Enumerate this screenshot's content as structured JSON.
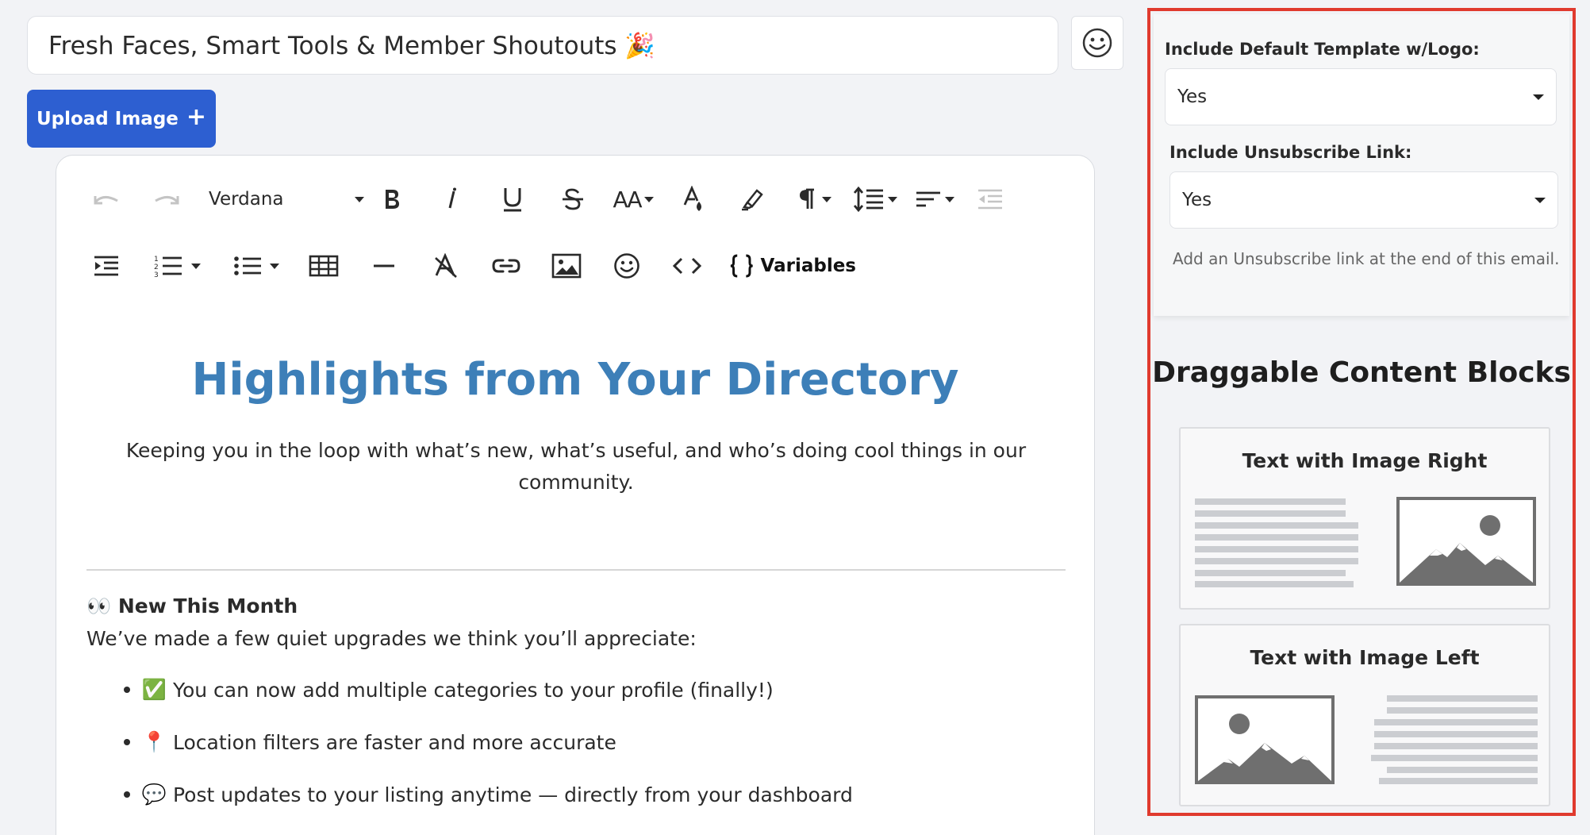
{
  "subject": {
    "value": "Fresh Faces, Smart Tools & Member Shoutouts 🎉"
  },
  "emoji_picker": {
    "icon": "smiley-icon"
  },
  "upload": {
    "label": "Upload Image",
    "plus": "+"
  },
  "toolbar": {
    "font_family": "Verdana",
    "variables_label": "Variables",
    "text_size_label": "AA",
    "icons": [
      "undo-icon",
      "redo-icon",
      "bold-icon",
      "italic-icon",
      "underline-icon",
      "strikethrough-icon",
      "text-size-icon",
      "font-color-icon",
      "highlight-icon",
      "paragraph-icon",
      "line-height-icon",
      "align-icon",
      "outdent-icon",
      "indent-icon",
      "ordered-list-icon",
      "unordered-list-icon",
      "table-icon",
      "horizontal-rule-icon",
      "clear-format-icon",
      "link-icon",
      "image-icon",
      "emoji-icon",
      "code-view-icon",
      "variables-icon"
    ]
  },
  "content": {
    "title": "Highlights from Your Directory",
    "intro": "Keeping you in the loop with what’s new, what’s useful, and who’s doing cool things in our community.",
    "section_heading": "New This Month",
    "section_body": "We’ve made a few quiet upgrades we think you’ll appreciate:",
    "bullets": [
      {
        "emoji": "✅",
        "text": "You can now add multiple categories to your profile (finally!)"
      },
      {
        "emoji": "📍",
        "text": "Location filters are faster and more accurate"
      },
      {
        "emoji": "💬",
        "text": "Post updates to your listing anytime — directly from your dashboard"
      }
    ]
  },
  "settings": {
    "default_template_label": "Include Default Template w/Logo:",
    "default_template_value": "Yes",
    "unsubscribe_label": "Include Unsubscribe Link:",
    "unsubscribe_value": "Yes",
    "unsubscribe_help": "Add an Unsubscribe link at the end of this email."
  },
  "blocks": {
    "heading": "Draggable Content Blocks",
    "items": [
      {
        "title": "Text with Image Right"
      },
      {
        "title": "Text with Image Left"
      }
    ]
  },
  "colors": {
    "accent": "#2d5fd1",
    "title_blue": "#3d7fb8",
    "highlight_border": "#e03a2e"
  }
}
